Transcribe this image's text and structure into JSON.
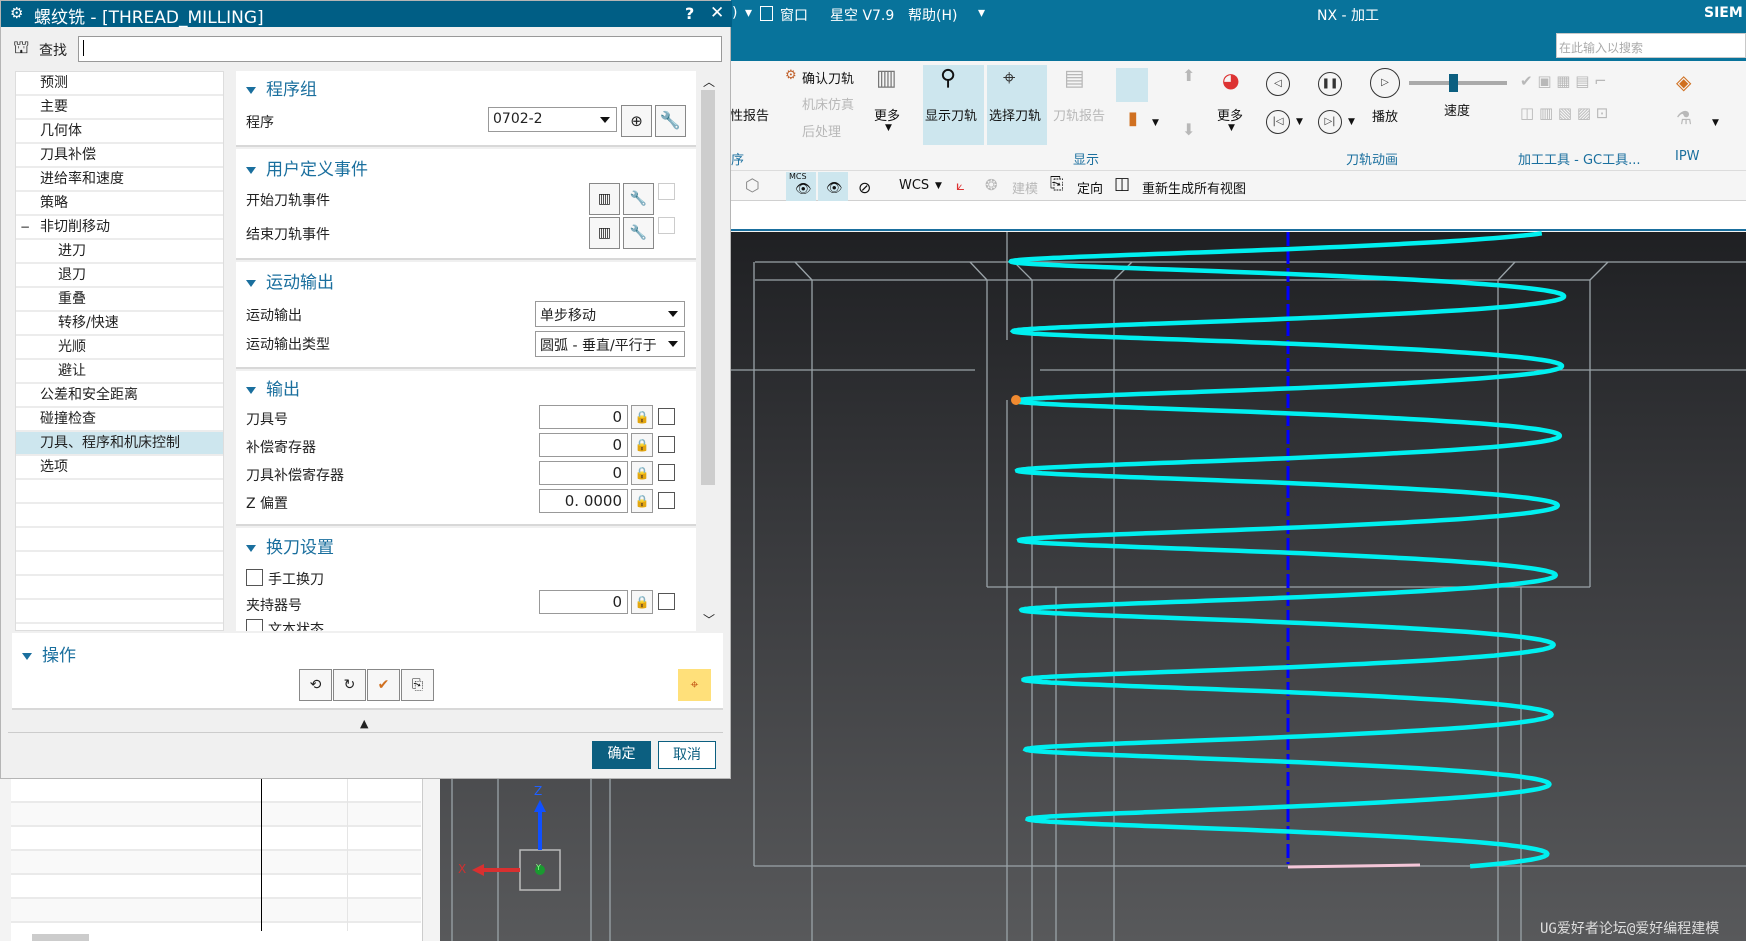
{
  "app": {
    "menu_partial": ")",
    "window_menu": "窗口",
    "plugin_menu": "星空 V7.9",
    "help_menu": "帮助(H)",
    "title": "NX - 加工",
    "brand": "SIEM",
    "search_placeholder": "在此输入以搜索"
  },
  "ribbon": {
    "report_partial": "性报告",
    "verify": "确认刀轨",
    "machine_sim": "机床仿真",
    "post": "后处理",
    "more1": "更多",
    "show_path": "显示刀轨",
    "select_path": "选择刀轨",
    "path_report": "刀轨报告",
    "more2": "更多",
    "play": "播放",
    "speed": "速度",
    "speed_value": 0.45,
    "groups": {
      "partial": "序",
      "display": "显示",
      "animation": "刀轨动画",
      "tools": "加工工具 - GC工具...",
      "ipw": "IPW"
    }
  },
  "toolbar2": {
    "mcs": "MCS",
    "wcs": "WCS",
    "modeling": "建模",
    "orient": "定向",
    "regen": "重新生成所有视图"
  },
  "dialog": {
    "title": "螺纹铣 - [THREAD_MILLING]",
    "help": "?",
    "close": "✕",
    "find_label": "查找",
    "find_value": "",
    "tree": [
      {
        "label": "预测",
        "level": 1
      },
      {
        "label": "主要",
        "level": 1
      },
      {
        "label": "几何体",
        "level": 1
      },
      {
        "label": "刀具补偿",
        "level": 1
      },
      {
        "label": "进给率和速度",
        "level": 1
      },
      {
        "label": "策略",
        "level": 1
      },
      {
        "label": "非切削移动",
        "level": 1,
        "expanded": true
      },
      {
        "label": "进刀",
        "level": 2
      },
      {
        "label": "退刀",
        "level": 2
      },
      {
        "label": "重叠",
        "level": 2
      },
      {
        "label": "转移/快速",
        "level": 2
      },
      {
        "label": "光顺",
        "level": 2
      },
      {
        "label": "避让",
        "level": 2
      },
      {
        "label": "公差和安全距离",
        "level": 1
      },
      {
        "label": "碰撞检查",
        "level": 1
      },
      {
        "label": "刀具、程序和机床控制",
        "level": 1,
        "selected": true
      },
      {
        "label": "选项",
        "level": 1
      }
    ],
    "program_group": {
      "header": "程序组",
      "program_label": "程序",
      "program_value": "0702-2"
    },
    "user_events": {
      "header": "用户定义事件",
      "start": "开始刀轨事件",
      "end": "结束刀轨事件"
    },
    "motion_output": {
      "header": "运动输出",
      "output_label": "运动输出",
      "output_value": "单步移动",
      "type_label": "运动输出类型",
      "type_value": "圆弧 - 垂直/平行于"
    },
    "output": {
      "header": "输出",
      "rows": [
        {
          "label": "刀具号",
          "value": "0"
        },
        {
          "label": "补偿寄存器",
          "value": "0"
        },
        {
          "label": "刀具补偿寄存器",
          "value": "0"
        },
        {
          "label": "Z 偏置",
          "value": "0. 0000"
        }
      ]
    },
    "tool_change": {
      "header": "换刀设置",
      "manual": "手工换刀",
      "holder_label": "夹持器号",
      "holder_value": "0",
      "text_status": "文本状态"
    },
    "actions": {
      "header": "操作"
    },
    "ok": "确定",
    "cancel": "取消"
  },
  "viewport": {
    "axis_z": "Z",
    "axis_x": "X",
    "axis_y": "Y",
    "watermark": "UG爱好者论坛@爱好编程建模",
    "toolpath_color": "#00f0f0",
    "axis_color": "#0000ff"
  }
}
